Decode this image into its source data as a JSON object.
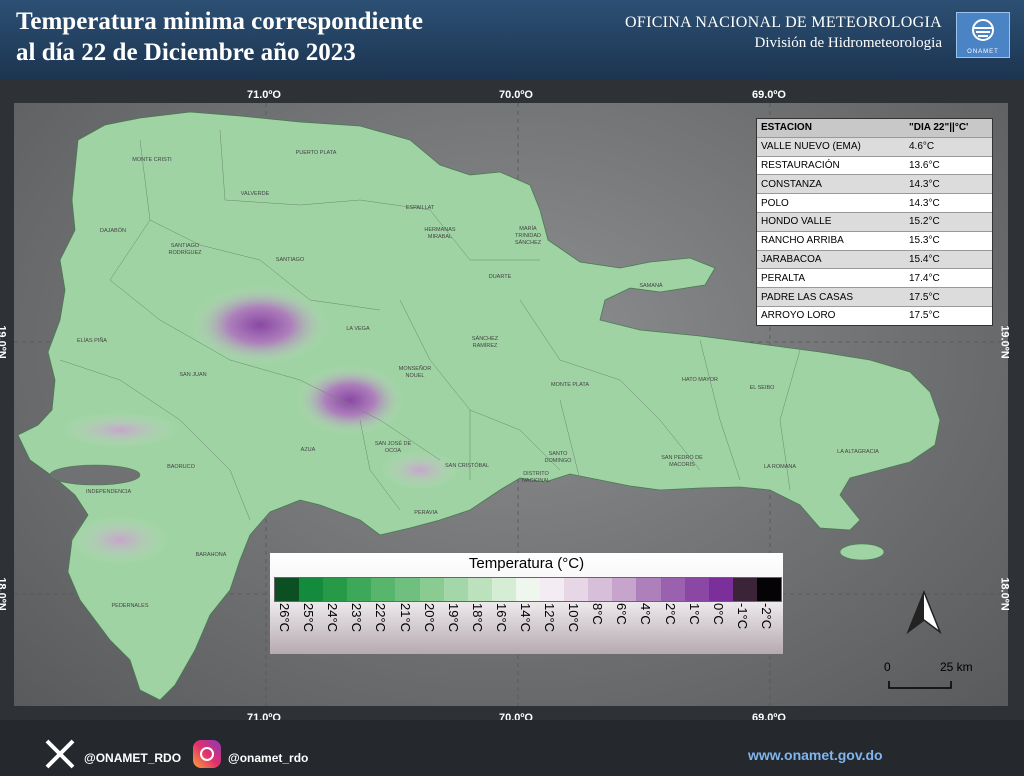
{
  "header": {
    "title_line1": "Temperatura minima correspondiente",
    "title_line2": "al día 22  de Diciembre  año 2023",
    "org_line1": "OFICINA NACIONAL DE METEOROLOGIA",
    "org_line2": "División de Hidrometeorologia",
    "logo_text": "ONAMET"
  },
  "coords": {
    "lon": [
      "71.0ºO",
      "70.0ºO",
      "69.0ºO"
    ],
    "lat": [
      "19.0ºN",
      "18.0ºN"
    ]
  },
  "table": {
    "header": [
      "ESTACION",
      "\"DIA 22\"||°C'"
    ],
    "rows": [
      [
        "VALLE NUEVO (EMA)",
        "4.6°C"
      ],
      [
        "RESTAURACIÓN",
        "13.6°C"
      ],
      [
        "CONSTANZA",
        "14.3°C"
      ],
      [
        "POLO",
        "14.3°C"
      ],
      [
        "HONDO VALLE",
        "15.2°C"
      ],
      [
        "RANCHO ARRIBA",
        "15.3°C"
      ],
      [
        "JARABACOA",
        "15.4°C"
      ],
      [
        "PERALTA",
        "17.4°C"
      ],
      [
        "PADRE LAS CASAS",
        "17.5°C"
      ],
      [
        "ARROYO LORO",
        "17.5°C"
      ]
    ]
  },
  "legend": {
    "title": "Temperatura (°C)",
    "labels": [
      "26°C",
      "25°C",
      "24°C",
      "23°C",
      "22°C",
      "21°C",
      "20°C",
      "19°C",
      "18°C",
      "16°C",
      "14°C",
      "12°C",
      "10°C",
      "8°C",
      "6°C",
      "4°C",
      "2°C",
      "1°C",
      "0°C",
      "-1°C",
      "-2°C"
    ],
    "colors": [
      "#0b4f23",
      "#148a3c",
      "#279a48",
      "#3ea85a",
      "#58b56c",
      "#6fc07e",
      "#8acb92",
      "#a3d6a8",
      "#bce1bd",
      "#d5ecd5",
      "#eef6ee",
      "#f3ecf2",
      "#e6d6e6",
      "#d7bfd9",
      "#c6a4cc",
      "#ad80bb",
      "#9a62ae",
      "#8a48a4",
      "#7a2f9a",
      "#3b2438",
      "#050305"
    ]
  },
  "places": [
    {
      "name": "MONTE CRISTI"
    },
    {
      "name": "PUERTO PLATA"
    },
    {
      "name": "VALVERDE"
    },
    {
      "name": "DAJABÓN"
    },
    {
      "name": "SANTIAGO RODRÍGUEZ"
    },
    {
      "name": "SANTIAGO"
    },
    {
      "name": "ESPAILLAT"
    },
    {
      "name": "HERMANAS MIRABAL"
    },
    {
      "name": "MARÍA TRINIDAD SÁNCHEZ"
    },
    {
      "name": "DUARTE"
    },
    {
      "name": "SAMANÁ"
    },
    {
      "name": "ELÍAS PIÑA"
    },
    {
      "name": "LA VEGA"
    },
    {
      "name": "SÁNCHEZ RAMÍREZ"
    },
    {
      "name": "SAN JUAN"
    },
    {
      "name": "MONSEÑOR NOUEL"
    },
    {
      "name": "MONTE PLATA"
    },
    {
      "name": "HATO MAYOR"
    },
    {
      "name": "EL SEIBO"
    },
    {
      "name": "SAN JOSÉ DE OCOA"
    },
    {
      "name": "AZUA"
    },
    {
      "name": "BAORUCO"
    },
    {
      "name": "SAN CRISTÓBAL"
    },
    {
      "name": "SANTO DOMINGO"
    },
    {
      "name": "DISTRITO NACIONAL"
    },
    {
      "name": "SAN PEDRO DE MACORÍS"
    },
    {
      "name": "LA ROMANA"
    },
    {
      "name": "LA ALTAGRACIA"
    },
    {
      "name": "INDEPENDENCIA"
    },
    {
      "name": "PERAVIA"
    },
    {
      "name": "BARAHONA"
    },
    {
      "name": "PEDERNALES"
    }
  ],
  "scale": {
    "zero": "0",
    "distance": "25 km"
  },
  "footer": {
    "x_handle": "@ONAMET_RDO",
    "ig_handle": "@onamet_rdo",
    "website": "www.onamet.gov.do"
  }
}
